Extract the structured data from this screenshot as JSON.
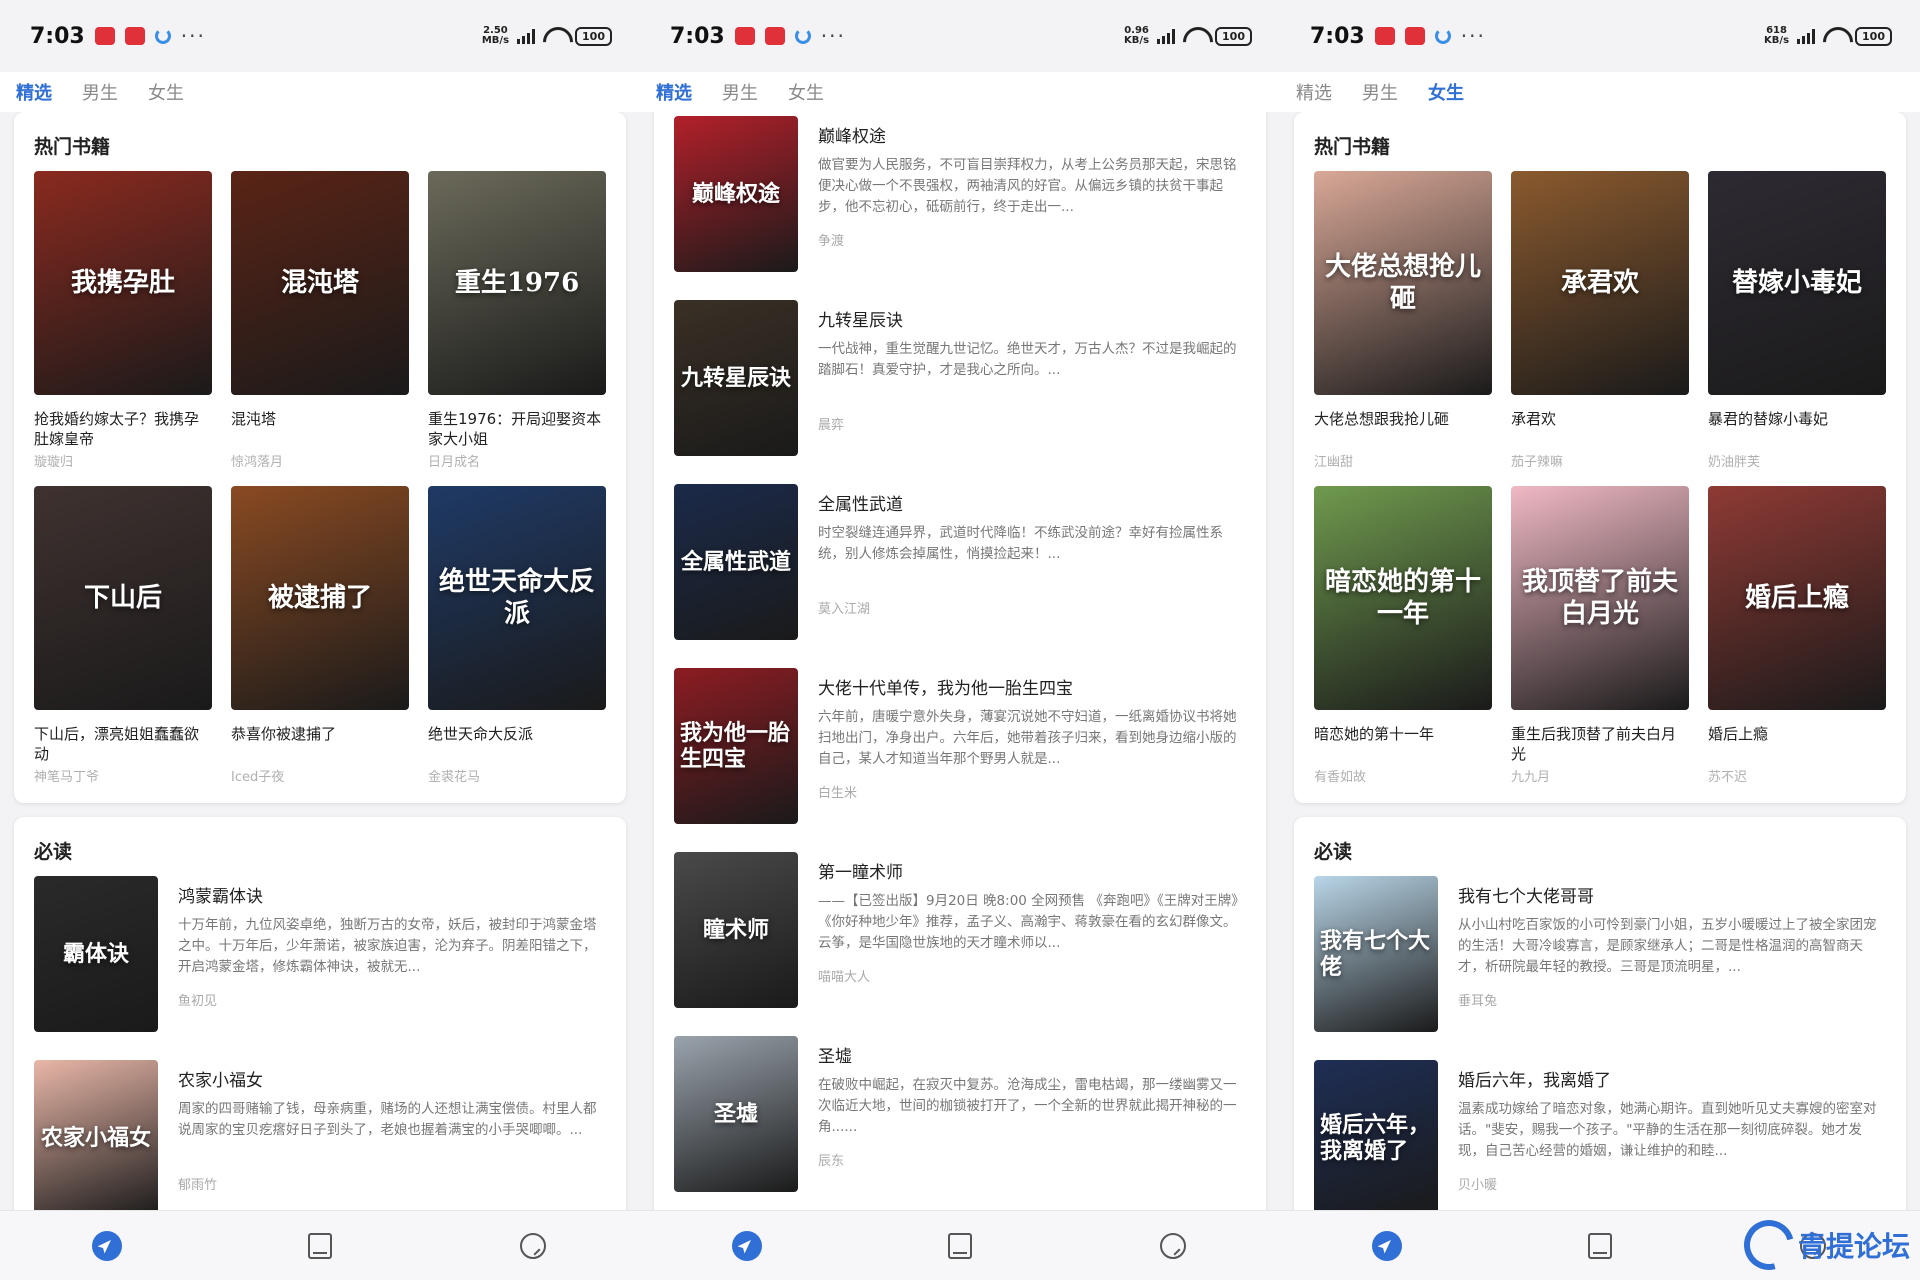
{
  "status": {
    "time": "7:03",
    "battery": "100",
    "phones": [
      {
        "net_top": "2.50",
        "net_bottom": "MB/s"
      },
      {
        "net_top": "0.96",
        "net_bottom": "KB/s"
      },
      {
        "net_top": "618",
        "net_bottom": "KB/s"
      }
    ]
  },
  "tabs": [
    "精选",
    "男生",
    "女生"
  ],
  "icons": {
    "nav": [
      "compass-icon",
      "bookshelf-icon",
      "profile-icon"
    ]
  },
  "colors": {
    "accent": "#2f6fd6"
  },
  "phone1": {
    "hot_title": "热门书籍",
    "hot_books": [
      {
        "title": "抢我婚约嫁太子？我携孕肚嫁皇帝",
        "author": "璇璇归",
        "cover_text": "我携孕肚",
        "cover_color": "#8a2a1f"
      },
      {
        "title": "混沌塔",
        "author": "惊鸿落月",
        "cover_text": "混沌塔",
        "cover_color": "#5a2416"
      },
      {
        "title": "重生1976：开局迎娶资本家大小姐",
        "author": "日月成名",
        "cover_text": "重生1976",
        "cover_color": "#6b6a5a"
      },
      {
        "title": "下山后，漂亮姐姐蠢蠢欲动",
        "author": "神笔马丁爷",
        "cover_text": "下山后",
        "cover_color": "#3f3230"
      },
      {
        "title": "恭喜你被逮捕了",
        "author": "Iced子夜",
        "cover_text": "被逮捕了",
        "cover_color": "#8a4a22"
      },
      {
        "title": "绝世天命大反派",
        "author": "金裘花马",
        "cover_text": "绝世天命大反派",
        "cover_color": "#1f3a66"
      }
    ],
    "must_title": "必读",
    "must_books": [
      {
        "title": "鸿蒙霸体诀",
        "desc": "十万年前，九位风姿卓绝，独断万古的女帝，妖后，被封印于鸿蒙金塔之中。十万年后，少年萧诺，被家族迫害，沦为弃子。阴差阳错之下，开启鸿蒙金塔，修炼霸体神诀，被就无...",
        "author": "鱼初见",
        "cover_text": "霸体诀",
        "cover_color": "#2a2a2a"
      },
      {
        "title": "农家小福女",
        "desc": "周家的四哥赌输了钱，母亲病重，赌场的人还想让满宝偿债。村里人都说周家的宝贝疙瘩好日子到头了，老娘也握着满宝的小手哭唧唧。...",
        "author": "郁雨竹",
        "cover_text": "农家小福女",
        "cover_color": "#e9b7a8"
      }
    ]
  },
  "phone2": {
    "books": [
      {
        "title": "巅峰权途",
        "desc": "做官要为人民服务，不可盲目崇拜权力，从考上公务员那天起，宋思铭便决心做一个不畏强权，两袖清风的好官。从偏远乡镇的扶贫干事起步，他不忘初心，砥砺前行，终于走出一...",
        "author": "争渡",
        "cover_text": "巅峰权途",
        "cover_color": "#b3202a"
      },
      {
        "title": "九转星辰诀",
        "desc": "一代战神，重生觉醒九世记忆。绝世天才，万古人杰？不过是我崛起的踏脚石！真爱守护，才是我心之所向。...",
        "author": "晨弈",
        "cover_text": "九转星辰诀",
        "cover_color": "#3a3025"
      },
      {
        "title": "全属性武道",
        "desc": "时空裂缝连通异界，武道时代降临！不练武没前途？幸好有捡属性系统，别人修炼会掉属性，悄摸捡起来！...",
        "author": "莫入江湖",
        "cover_text": "全属性武道",
        "cover_color": "#1b2a4a"
      },
      {
        "title": "大佬十代单传，我为他一胎生四宝",
        "desc": "六年前，唐暖宁意外失身，薄宴沉说她不守妇道，一纸离婚协议书将她扫地出门，净身出户。六年后，她带着孩子归来，看到她身边缩小版的自己，某人才知道当年那个野男人就是...",
        "author": "白生米",
        "cover_text": "我为他一胎生四宝",
        "cover_color": "#8c1c22"
      },
      {
        "title": "第一瞳术师",
        "desc": "——【已签出版】9月20日 晚8:00 全网预售 《奔跑吧》《王牌对王牌》《你好种地少年》推荐，孟子义、高瀚宇、蒋敦豪在看的玄幻群像文。云筝，是华国隐世族地的天才瞳术师以...",
        "author": "喵喵大人",
        "cover_text": "瞳术师",
        "cover_color": "#4a4a4a"
      },
      {
        "title": "圣墟",
        "desc": "在破败中崛起，在寂灭中复苏。沧海成尘，雷电枯竭，那一缕幽雾又一次临近大地，世间的枷锁被打开了，一个全新的世界就此揭开神秘的一角......",
        "author": "辰东",
        "cover_text": "圣墟",
        "cover_color": "#9aa4ad"
      }
    ]
  },
  "phone3": {
    "hot_title": "热门书籍",
    "hot_books": [
      {
        "title": "大佬总想跟我抢儿砸",
        "author": "江幽甜",
        "cover_text": "大佬总想抢儿砸",
        "cover_color": "#d9a897"
      },
      {
        "title": "承君欢",
        "author": "茄子辣嘛",
        "cover_text": "承君欢",
        "cover_color": "#8b5a2e"
      },
      {
        "title": "暴君的替嫁小毒妃",
        "author": "奶油胖芙",
        "cover_text": "替嫁小毒妃",
        "cover_color": "#2e2a33"
      },
      {
        "title": "暗恋她的第十一年",
        "author": "有香如故",
        "cover_text": "暗恋她的第十一年",
        "cover_color": "#6f9a4e"
      },
      {
        "title": "重生后我顶替了前夫白月光",
        "author": "九九月",
        "cover_text": "我顶替了前夫白月光",
        "cover_color": "#f0b9c4"
      },
      {
        "title": "婚后上瘾",
        "author": "苏不迟",
        "cover_text": "婚后上瘾",
        "cover_color": "#8f3a34"
      }
    ],
    "must_title": "必读",
    "must_books": [
      {
        "title": "我有七个大佬哥哥",
        "desc": "从小山村吃百家饭的小可怜到豪门小姐，五岁小暖暖过上了被全家团宠的生活！大哥冷峻寡言，是顾家继承人；二哥是性格温润的高智商天才，析研院最年轻的教授。三哥是顶流明星，...",
        "author": "垂耳兔",
        "cover_text": "我有七个大佬",
        "cover_color": "#b9d6e8"
      },
      {
        "title": "婚后六年，我离婚了",
        "desc": "温素成功嫁给了暗恋对象，她满心期许。直到她听见丈夫寡嫂的密室对话。\"斐安，赐我一个孩子。\"平静的生活在那一刻彻底碎裂。她才发现，自己苦心经营的婚姻，谦让维护的和睦...",
        "author": "贝小暖",
        "cover_text": "婚后六年，我离婚了",
        "cover_color": "#1e2e55"
      }
    ]
  },
  "watermark": "青提论坛"
}
